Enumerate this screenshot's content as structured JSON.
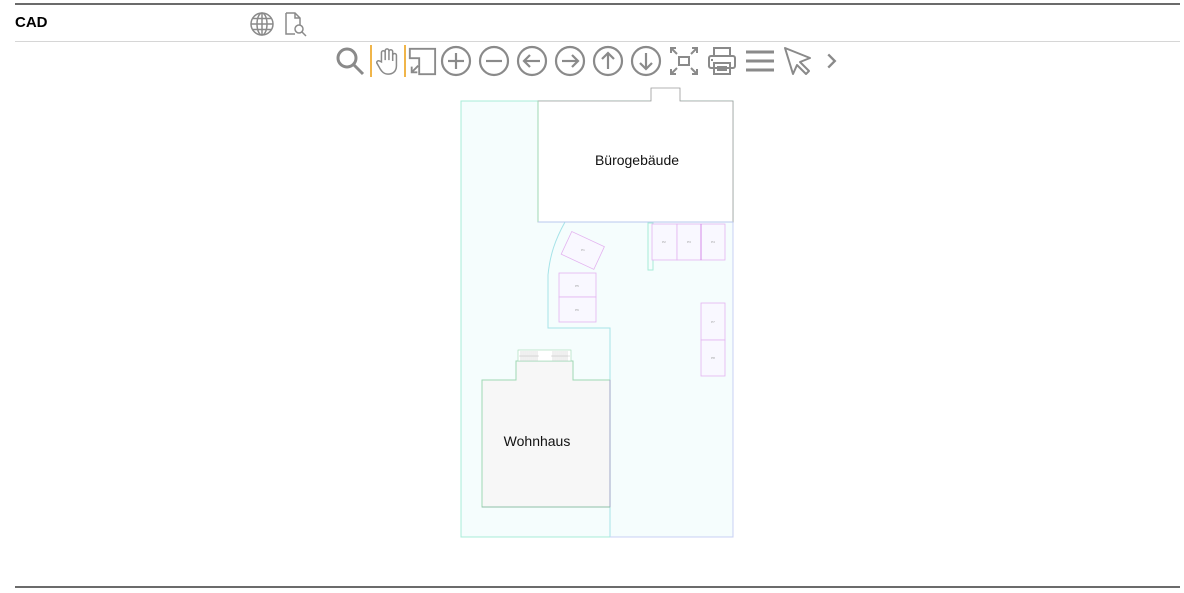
{
  "header": {
    "title": "CAD",
    "icons": [
      {
        "name": "globe-icon",
        "label": "Globe"
      },
      {
        "name": "document-search-icon",
        "label": "Document preview"
      }
    ]
  },
  "toolbar": {
    "tools": [
      {
        "name": "zoom-search",
        "icon": "magnifier-icon"
      },
      {
        "name": "pan",
        "icon": "hand-icon"
      },
      {
        "name": "zoom-window",
        "icon": "zoom-window-icon"
      },
      {
        "name": "zoom-in",
        "icon": "plus-circle-icon"
      },
      {
        "name": "zoom-out",
        "icon": "minus-circle-icon"
      },
      {
        "name": "pan-left",
        "icon": "arrow-left-circle-icon"
      },
      {
        "name": "pan-right",
        "icon": "arrow-right-circle-icon"
      },
      {
        "name": "pan-up",
        "icon": "arrow-up-circle-icon"
      },
      {
        "name": "pan-down",
        "icon": "arrow-down-circle-icon"
      },
      {
        "name": "zoom-extents",
        "icon": "fit-extents-icon"
      },
      {
        "name": "print",
        "icon": "printer-icon"
      },
      {
        "name": "menu",
        "icon": "hamburger-icon"
      },
      {
        "name": "select",
        "icon": "pointer-icon"
      },
      {
        "name": "more",
        "icon": "chevron-right-icon"
      }
    ]
  },
  "drawing": {
    "buildings": [
      {
        "label": "Bürogebäude"
      },
      {
        "label": "Wohnhaus"
      }
    ],
    "parking_spots": [
      "P1",
      "P2",
      "P3",
      "P4",
      "P5",
      "P6",
      "P7",
      "P8"
    ],
    "colors": {
      "site_outline": "#a8ecd8",
      "site_fill": "#f5fdfd",
      "building_outline": "#9fd8b4",
      "building_fill_house": "#f7f7f7",
      "parking_outline": "#e3b3f0",
      "parking_fill": "#f9f8ff",
      "path_outline": "#a6e3e8",
      "tool_icon": "#8a8a8a",
      "tool_separator": "#f0b54a"
    }
  }
}
